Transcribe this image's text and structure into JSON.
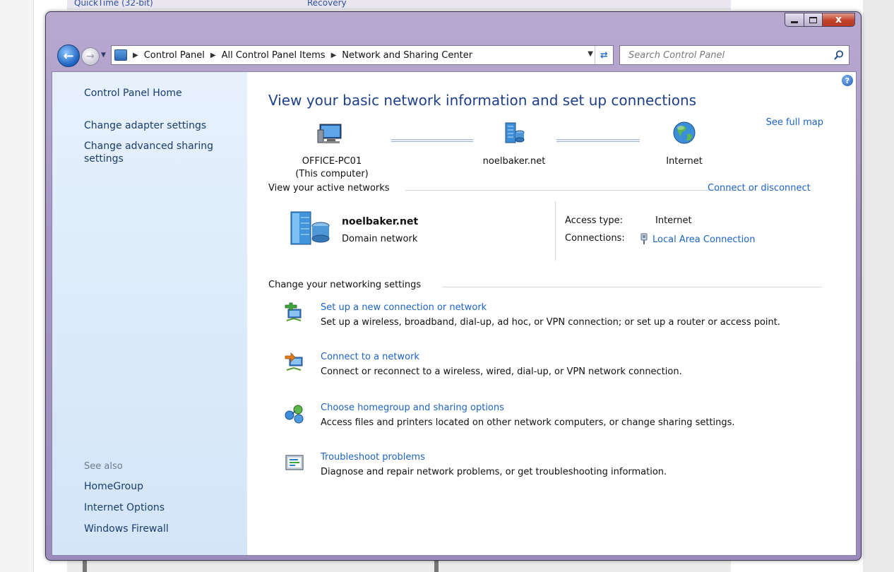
{
  "background": {
    "top_items": [
      "QuickTime (32-bit)",
      "Recovery"
    ]
  },
  "window": {
    "close_glyph": "x"
  },
  "address_bar": {
    "crumbs": [
      "Control Panel",
      "All Control Panel Items",
      "Network and Sharing Center"
    ],
    "search_placeholder": "Search Control Panel"
  },
  "sidebar": {
    "home": "Control Panel Home",
    "tasks": [
      "Change adapter settings",
      "Change advanced sharing settings"
    ],
    "see_also_heading": "See also",
    "see_also": [
      "HomeGroup",
      "Internet Options",
      "Windows Firewall"
    ]
  },
  "main": {
    "title": "View your basic network information and set up connections",
    "see_full_map": "See full map",
    "map": {
      "computer_name": "OFFICE-PC01",
      "computer_sub": "(This computer)",
      "network": "noelbaker.net",
      "internet": "Internet"
    },
    "active_networks": {
      "heading": "View your active networks",
      "connect_link": "Connect or disconnect",
      "network_name": "noelbaker.net",
      "network_type": "Domain network",
      "access_type_label": "Access type:",
      "access_type_value": "Internet",
      "connections_label": "Connections:",
      "connections_value": "Local Area Connection"
    },
    "settings": {
      "heading": "Change your networking settings",
      "tasks": [
        {
          "link": "Set up a new connection or network",
          "desc": "Set up a wireless, broadband, dial-up, ad hoc, or VPN connection; or set up a router or access point."
        },
        {
          "link": "Connect to a network",
          "desc": "Connect or reconnect to a wireless, wired, dial-up, or VPN network connection."
        },
        {
          "link": "Choose homegroup and sharing options",
          "desc": "Access files and printers located on other network computers, or change sharing settings."
        },
        {
          "link": "Troubleshoot problems",
          "desc": "Diagnose and repair network problems, or get troubleshooting information."
        }
      ]
    }
  },
  "colors": {
    "link": "#1c63c5",
    "title": "#1e3f8a",
    "sidebar_bg": "#dcebfa",
    "frame": "#a897c5"
  }
}
